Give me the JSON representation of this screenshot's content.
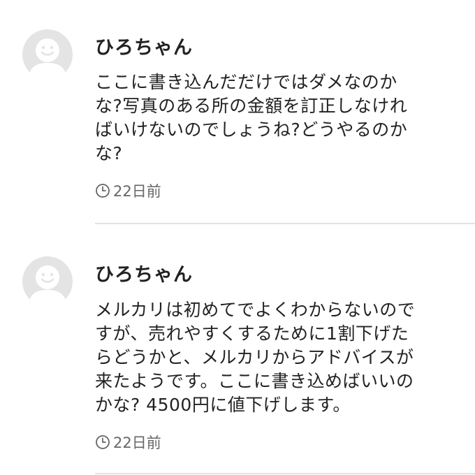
{
  "comments": [
    {
      "author": "ひろちゃん",
      "body": "ここに書き込んだだけではダメなのか\nな?写真のある所の金額を訂正しなけれ\nばいけないのでしょうね?どうやるのか\nな?",
      "timestamp": "22日前",
      "avatar_icon": "default-user-smile-icon",
      "time_icon": "clock-icon"
    },
    {
      "author": "ひろちゃん",
      "body": "メルカリは初めてでよくわからないので\nすが、売れやすくするために1割下げた\nらどうかと、メルカリからアドバイスが\n来たようです。ここに書き込めばいいの\nかな? 4500円に値下げします。",
      "timestamp": "22日前",
      "avatar_icon": "default-user-smile-icon",
      "time_icon": "clock-icon"
    }
  ],
  "colors": {
    "background": "#ffffff",
    "text": "#222222",
    "muted": "#666666",
    "avatar_bg": "#e4e4e4",
    "avatar_fg": "#ffffff",
    "divider": "#e2e2e2"
  }
}
